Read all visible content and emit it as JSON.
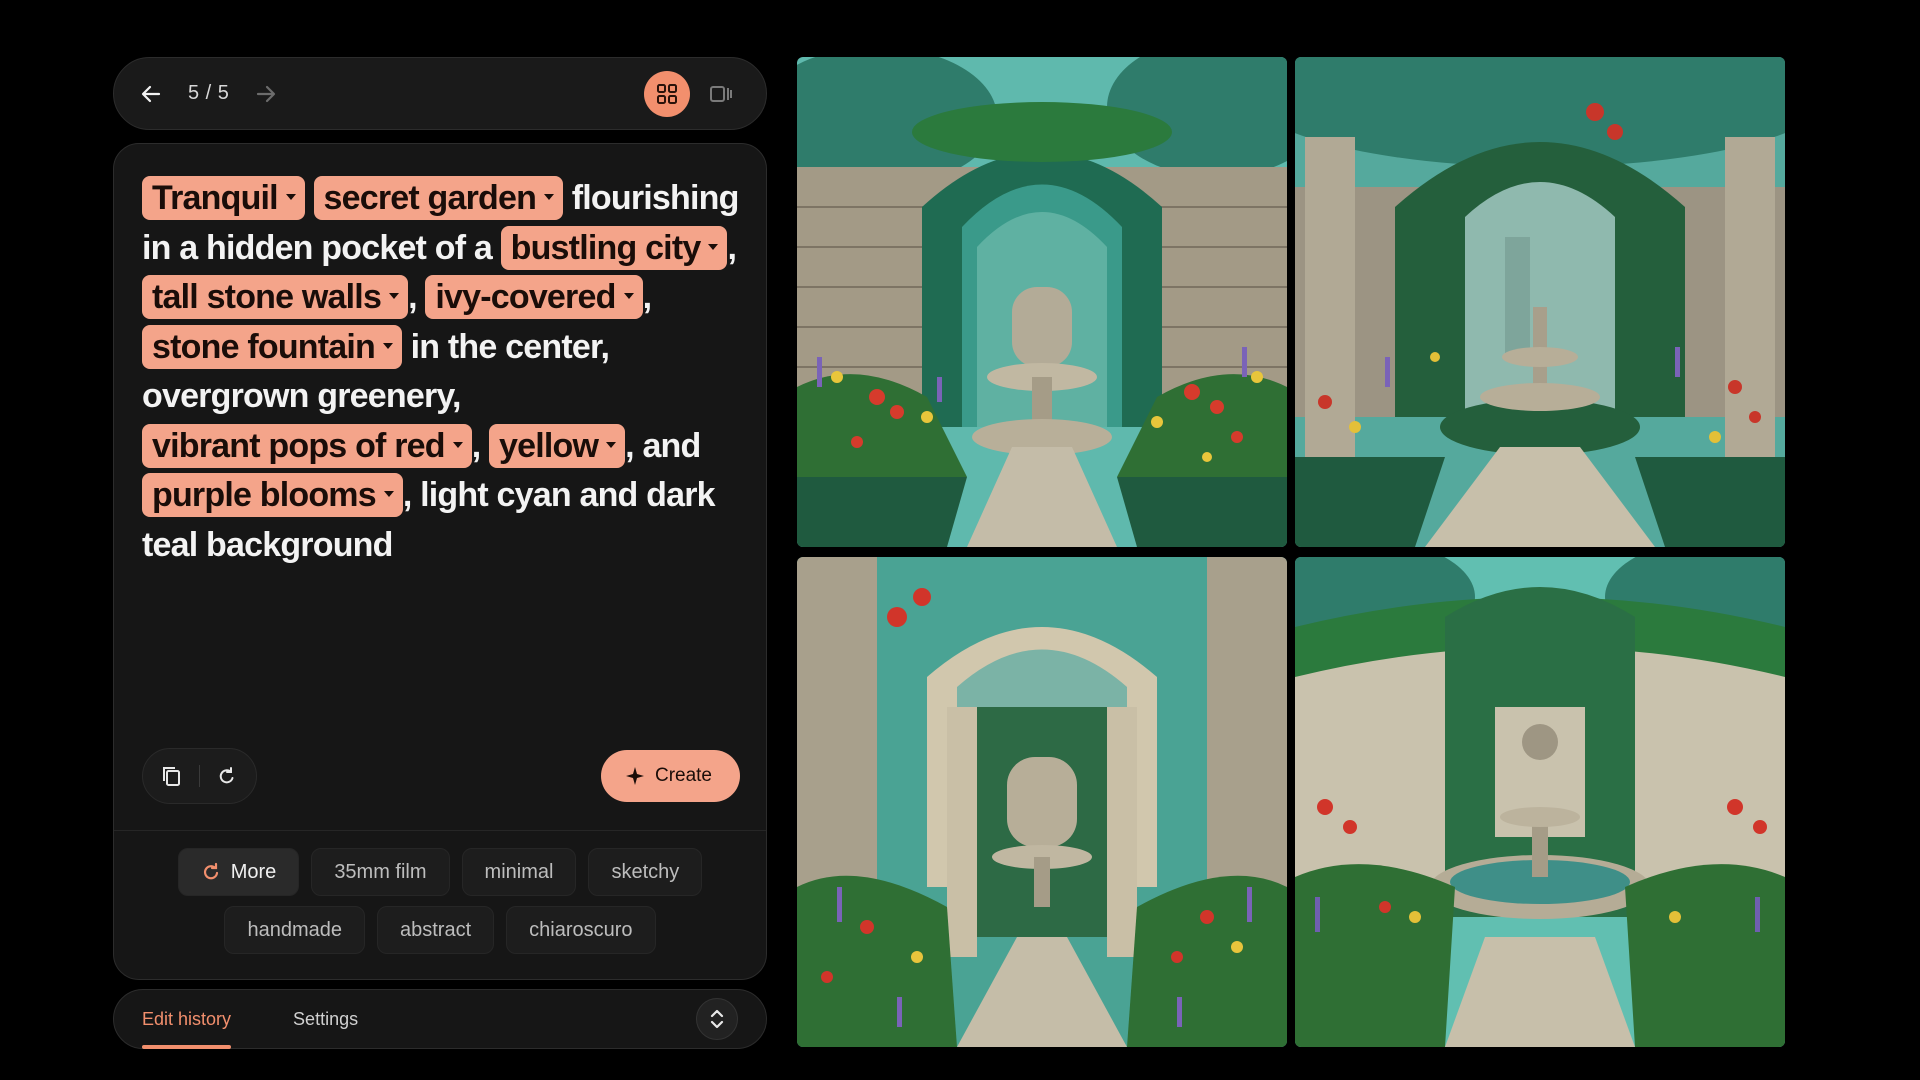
{
  "topbar": {
    "counter": "5 / 5",
    "icons": {
      "back": "arrow-left-icon",
      "forward": "arrow-right-icon",
      "grid": "grid-view-icon",
      "single": "single-view-icon"
    }
  },
  "prompt": {
    "segments": [
      {
        "chip": true,
        "text": "Tranquil"
      },
      {
        "chip": false,
        "text": " "
      },
      {
        "chip": true,
        "text": "secret garden"
      },
      {
        "chip": false,
        "text": " flourishing in a hidden pocket of a "
      },
      {
        "chip": true,
        "text": "bustling city"
      },
      {
        "chip": false,
        "text": ", "
      },
      {
        "chip": true,
        "text": "tall stone walls"
      },
      {
        "chip": false,
        "text": ", "
      },
      {
        "chip": true,
        "text": "ivy-covered"
      },
      {
        "chip": false,
        "text": ", "
      },
      {
        "chip": true,
        "text": "stone fountain"
      },
      {
        "chip": false,
        "text": " in the center, overgrown greenery, "
      },
      {
        "chip": true,
        "text": "vibrant pops of red"
      },
      {
        "chip": false,
        "text": ", "
      },
      {
        "chip": true,
        "text": "yellow"
      },
      {
        "chip": false,
        "text": ", and "
      },
      {
        "chip": true,
        "text": "purple blooms"
      },
      {
        "chip": false,
        "text": ", light cyan and dark teal background"
      }
    ]
  },
  "actions": {
    "create_label": "Create",
    "icons": {
      "copy": "copy-icon",
      "reset": "refresh-icon",
      "create": "sparkle-icon"
    }
  },
  "styles": {
    "more_label": "More",
    "row1": [
      "35mm film",
      "minimal",
      "sketchy"
    ],
    "row2": [
      "handmade",
      "abstract",
      "chiaroscuro"
    ]
  },
  "bottom": {
    "tabs": [
      "Edit history",
      "Settings"
    ],
    "icons": {
      "expand": "expand-collapse-icon"
    }
  },
  "colors": {
    "accent": "#f28f6d",
    "chip": "#f4a48a",
    "panel": "#161616"
  },
  "images": [
    {
      "variant": "arch-fountain"
    },
    {
      "variant": "pillars-tiered-fountain"
    },
    {
      "variant": "arch-path"
    },
    {
      "variant": "lion-wall-fountain"
    }
  ]
}
